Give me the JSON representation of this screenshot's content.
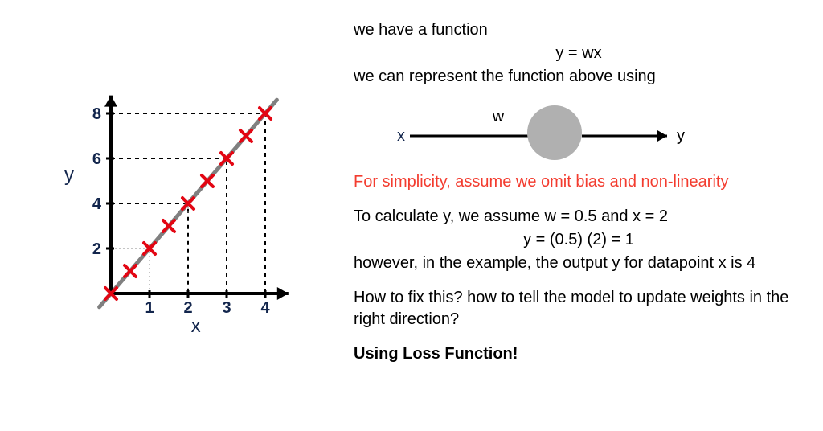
{
  "chart_data": {
    "type": "scatter",
    "title": "",
    "xlabel": "x",
    "ylabel": "y",
    "xlim": [
      0,
      4
    ],
    "ylim": [
      0,
      8
    ],
    "x_ticks": [
      1,
      2,
      3,
      4
    ],
    "y_ticks": [
      2,
      4,
      6,
      8
    ],
    "series": [
      {
        "name": "data",
        "x": [
          0,
          0.5,
          1,
          1.5,
          2,
          2.5,
          3,
          3.5,
          4
        ],
        "y": [
          0,
          1,
          2,
          3,
          4,
          5,
          6,
          7,
          8
        ]
      }
    ],
    "line": {
      "slope": 2,
      "intercept": 0
    },
    "guides": [
      {
        "x": 2,
        "y": 4
      },
      {
        "x": 3,
        "y": 6
      },
      {
        "x": 4,
        "y": 8
      }
    ]
  },
  "neuron": {
    "x_label": "x",
    "w_label": "w",
    "y_label": "y"
  },
  "text": {
    "l1": "we have a function",
    "l2": "y = wx",
    "l3": "we can represent the function above using",
    "l4": "For simplicity, assume we omit bias and non-linearity",
    "l5": "To calculate y, we assume w = 0.5 and x = 2",
    "l6": "y =  (0.5) (2)  = 1",
    "l7": "however, in the example, the output y for datapoint x is 4",
    "l8": "How to fix this? how to tell the model to update weights in the right direction?",
    "l9": "Using Loss Function!"
  }
}
